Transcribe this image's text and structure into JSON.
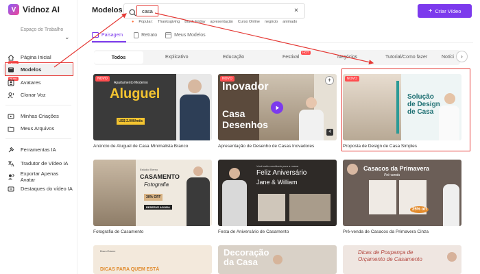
{
  "brand": {
    "name": "Vidnoz AI"
  },
  "sidebar": {
    "workspace_label": "Espaço de Trabalho",
    "items": [
      {
        "label": "Página Inicial",
        "icon": "home-icon"
      },
      {
        "label": "Modelos",
        "icon": "templates-icon",
        "badge": "Novo"
      },
      {
        "label": "Avatares",
        "icon": "avatar-icon",
        "badge": "Novo"
      },
      {
        "label": "Clonar Voz",
        "icon": "voice-clone-icon"
      },
      {
        "label": "Minhas Criações",
        "icon": "creations-icon"
      },
      {
        "label": "Meus Arquivos",
        "icon": "folder-icon"
      },
      {
        "label": "Ferramentas IA",
        "icon": "tools-icon"
      },
      {
        "label": "Tradutor de Vídeo IA",
        "icon": "translate-icon"
      },
      {
        "label": "Exportar Apenas Avatar",
        "icon": "export-avatar-icon"
      },
      {
        "label": "Destaques do vídeo IA",
        "icon": "highlights-icon"
      }
    ]
  },
  "header": {
    "title": "Modelos",
    "search_value": "casa",
    "popular_label": "Popular:",
    "popular_tags": [
      "Thanksgiving",
      "Black Friday",
      "apresentação",
      "Curso Online",
      "negócio",
      "animado"
    ],
    "create_button": "Criar Vídeo"
  },
  "tabs": [
    {
      "label": "Paisagem",
      "active": true
    },
    {
      "label": "Retrato",
      "active": false
    },
    {
      "label": "Meus Modelos",
      "active": false
    }
  ],
  "categories": [
    "Todos",
    "Explicativo",
    "Educação",
    "Festival",
    "Negócios",
    "Tutorial/Como fazer",
    "Notíci"
  ],
  "hot_badge": "HOT",
  "cards": [
    {
      "title": "Anúncio de Aluguel de Casa Minimalista Branco",
      "novo": true,
      "thumb": {
        "small": "Apartamento Moderno",
        "big": "Aluguel",
        "price": "US$ 2.000/mês"
      }
    },
    {
      "title": "Apresentação de Desenho de Casas Inovadores",
      "novo": true,
      "thumb": {
        "big1": "Inovador",
        "big2": "Casa",
        "big3": "Desenhos"
      }
    },
    {
      "title": "Proposta de Design de Casa Simples",
      "novo": true,
      "thumb": {
        "big": "Solução de Design de Casa"
      }
    },
    {
      "title": "Fotografia de Casamento",
      "novo": false,
      "thumb": {
        "small": "Estúdio Eterno",
        "big": "CASAMENTO",
        "sub": "Fotografia",
        "discount": "30% OFF",
        "cta": "RESERVE AGORA"
      }
    },
    {
      "title": "Festa de Aniversário de Casamento",
      "novo": false,
      "thumb": {
        "small": "Você está convidado para a nossa",
        "big": "Feliz Aniversário",
        "names": "Jane & William"
      }
    },
    {
      "title": "Pré-venda de Casacos da Primavera Cinza",
      "novo": false,
      "thumb": {
        "big": "Casacos da Primavera",
        "sub": "Pré-venda",
        "discount": "25% off"
      }
    },
    {
      "title": "",
      "novo": false,
      "thumb": {
        "small": "Brand Name",
        "big": "DICAS PARA QUEM ESTÁ"
      }
    },
    {
      "title": "",
      "novo": false,
      "thumb": {
        "big": "Decoração da Casa"
      }
    },
    {
      "title": "",
      "novo": false,
      "thumb": {
        "big": "Dicas de Poupança de Orçamento de Casamento"
      }
    }
  ]
}
